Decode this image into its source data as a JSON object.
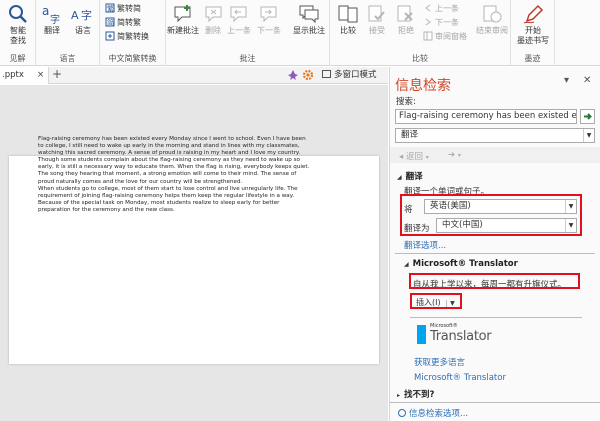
{
  "ribbon": {
    "smart_lookup": "智能\n查找",
    "insights_group": "见解",
    "translate": "翻译",
    "language": "语言",
    "language_group": "语言",
    "trad_to_simp": "繁转简",
    "simp_to_trad": "简转繁",
    "simp_trad_convert": "简繁转换",
    "chinese_conversion_group": "中文简繁转换",
    "new_comment": "新建批注",
    "delete": "删除",
    "previous": "上一条",
    "next": "下一条",
    "show_comments": "显示批注",
    "comments_group": "批注",
    "compare": "比较",
    "accept": "接受",
    "reject": "拒绝",
    "prev_change": "上一条",
    "next_change": "下一条",
    "reviewing_pane": "审阅窗格",
    "end_review": "结束审阅",
    "compare_group": "比较",
    "start_inking": "开始\n墨迹书写",
    "ink_group": "墨迹"
  },
  "tabs": {
    "doc_name": ".pptx",
    "multi_window": "多窗口模式"
  },
  "slide": {
    "lines": [
      "Flag-raising ceremony has been existed every Monday since I went to school. Even I have been",
      "to college, I still need to wake up early in the morning and stand in lines with my classmates,",
      "watching this sacred ceremony. A sense of proud is raising in my heart and I love my country.",
      "Though some students complain about the flag-raising ceremony as they need to wake up so",
      "early, it is still a necessary way to educate them. When the flag is rising, everybody keeps quiet.",
      "The song they hearing that moment, a strong emotion will come to their mind. The sense of",
      "proud naturally comes and the love for our country will be strengthened.",
      "When students go to college, most of them start to lose control and live unregularly life. The",
      "requirement of joining flag-raising ceremony helps them keep the regular lifestyle in a way.",
      "Because of the special task on Monday, most students realize to sleep early for better",
      "preparation for the ceremony and the new class."
    ]
  },
  "pane": {
    "title": "信息检索",
    "search_label": "搜索:",
    "search_value": "Flag-raising ceremony has been existed eve",
    "service": "翻译",
    "back": "返回",
    "translate_header": "翻译",
    "translate_desc": "翻译一个单词或句子。",
    "from_label": "将",
    "from_lang": "英语(美国)",
    "to_label": "翻译为",
    "to_lang": "中文(中国)",
    "translate_options": "翻译选项...",
    "ms_header": "Microsoft® Translator",
    "result": "自从我上学以来，每周一都有升旗仪式。",
    "insert": "插入(I)",
    "logo_small": "Microsoft®",
    "logo_big": "Translator",
    "more_languages": "获取更多语言",
    "ms_link": "Microsoft® Translator",
    "not_found": "找不到?",
    "research_options": "信息检索选项..."
  },
  "colors": {
    "accent": "#d04527",
    "highlight_box": "#e0111d",
    "link": "#2e6db4",
    "translator_logo": "#00a4ef"
  }
}
